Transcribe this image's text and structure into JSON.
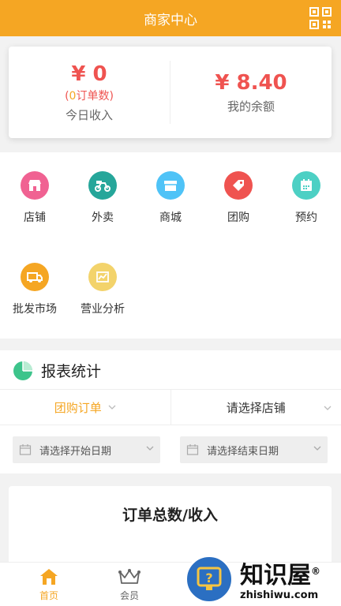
{
  "header": {
    "title": "商家中心",
    "icon": "qr-code-icon"
  },
  "summary": {
    "today_amount": "¥ 0",
    "order_count_open": "(",
    "order_count_num": "0",
    "order_count_close": "订单数)",
    "today_label": "今日收入",
    "balance_amount": "¥ 8.40",
    "balance_label": "我的余额"
  },
  "grid": [
    {
      "label": "店铺",
      "icon": "store-icon",
      "color": "#f06292"
    },
    {
      "label": "外卖",
      "icon": "scooter-icon",
      "color": "#26a69a"
    },
    {
      "label": "商城",
      "icon": "mall-icon",
      "color": "#4fc3f7"
    },
    {
      "label": "团购",
      "icon": "tag-icon",
      "color": "#ef5350"
    },
    {
      "label": "预约",
      "icon": "calendar-icon",
      "color": "#4dd0c4"
    },
    {
      "label": "批发市场",
      "icon": "truck-icon",
      "color": "#f5a623"
    },
    {
      "label": "营业分析",
      "icon": "chart-icon",
      "color": "#f3d36b"
    }
  ],
  "report": {
    "title": "报表统计",
    "icon": "pie-chart-icon",
    "filter_type": "团购订单",
    "filter_store": "请选择店铺",
    "start_date_placeholder": "请选择开始日期",
    "end_date_placeholder": "请选择结束日期"
  },
  "orders": {
    "title": "订单总数/收入"
  },
  "tabs": [
    {
      "label": "首页",
      "icon": "home-icon",
      "active": true
    },
    {
      "label": "会员",
      "icon": "crown-icon",
      "active": false
    }
  ],
  "watermark": {
    "cn": "知识屋",
    "reg": "®",
    "en": "zhishiwu.com",
    "icon": "help-monitor-icon"
  },
  "colors": {
    "accent": "#f5a623",
    "amount": "#ef5350"
  }
}
